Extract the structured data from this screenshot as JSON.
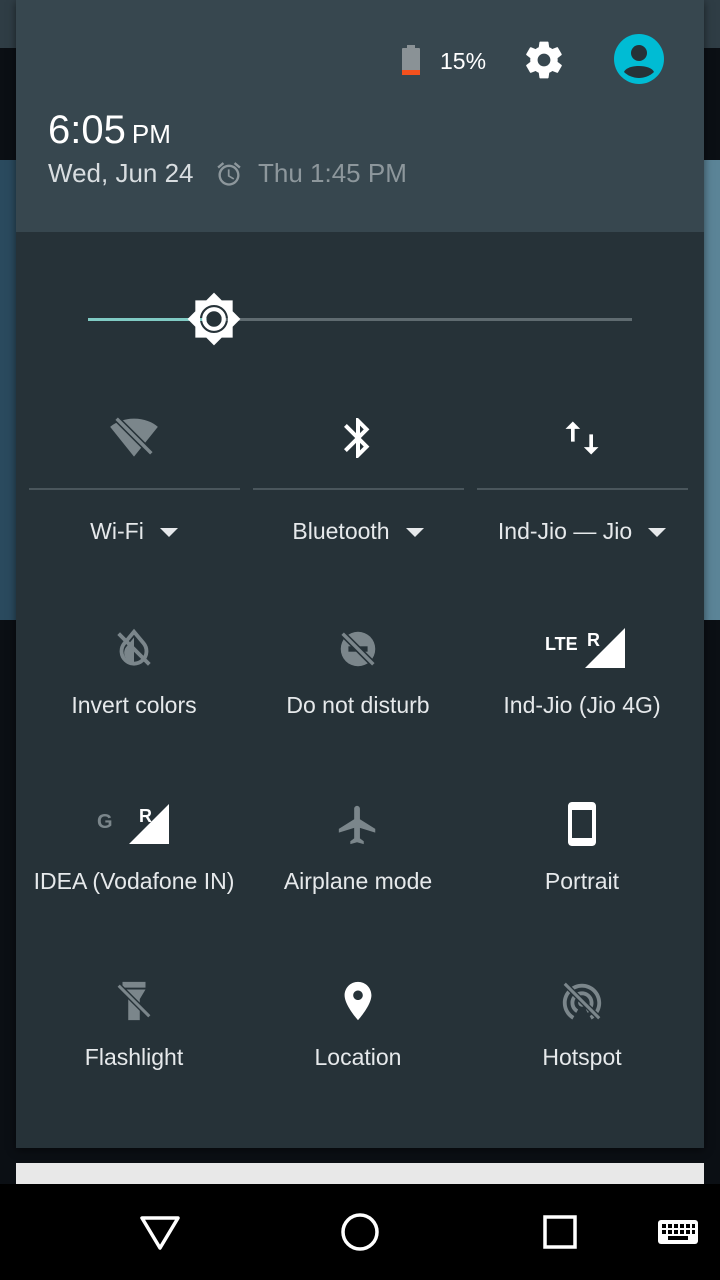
{
  "status": {
    "battery_percent": "15%",
    "battery_level": 0.15
  },
  "header": {
    "time": "6:05",
    "ampm": "PM",
    "date": "Wed, Jun 24",
    "alarm": "Thu 1:45 PM"
  },
  "brightness": {
    "level": 0.23
  },
  "tiles": {
    "wifi": {
      "label": "Wi-Fi",
      "icon": "wifi-off-icon"
    },
    "bluetooth": {
      "label": "Bluetooth",
      "icon": "bluetooth-icon"
    },
    "data": {
      "label": "Ind-Jio — Jio",
      "icon": "data-arrows-icon"
    },
    "invert": {
      "label": "Invert colors",
      "icon": "invert-colors-icon"
    },
    "dnd": {
      "label": "Do not disturb",
      "icon": "do-not-disturb-icon"
    },
    "jio": {
      "label": "Ind-Jio (Jio 4G)",
      "icon": "lte-signal-icon",
      "net": "LTE",
      "roam": "R"
    },
    "idea": {
      "label": "IDEA (Vodafone IN)",
      "icon": "g-signal-icon",
      "net": "G",
      "roam": "R"
    },
    "airplane": {
      "label": "Airplane mode",
      "icon": "airplane-icon"
    },
    "portrait": {
      "label": "Portrait",
      "icon": "portrait-icon"
    },
    "flashlight": {
      "label": "Flashlight",
      "icon": "flashlight-icon"
    },
    "location": {
      "label": "Location",
      "icon": "location-icon"
    },
    "hotspot": {
      "label": "Hotspot",
      "icon": "hotspot-icon"
    }
  },
  "colors": {
    "shade": "#263238",
    "header": "#37474f",
    "accent": "#80cbc4",
    "avatar": "#00bcd4",
    "battery_low": "#f4511e"
  }
}
